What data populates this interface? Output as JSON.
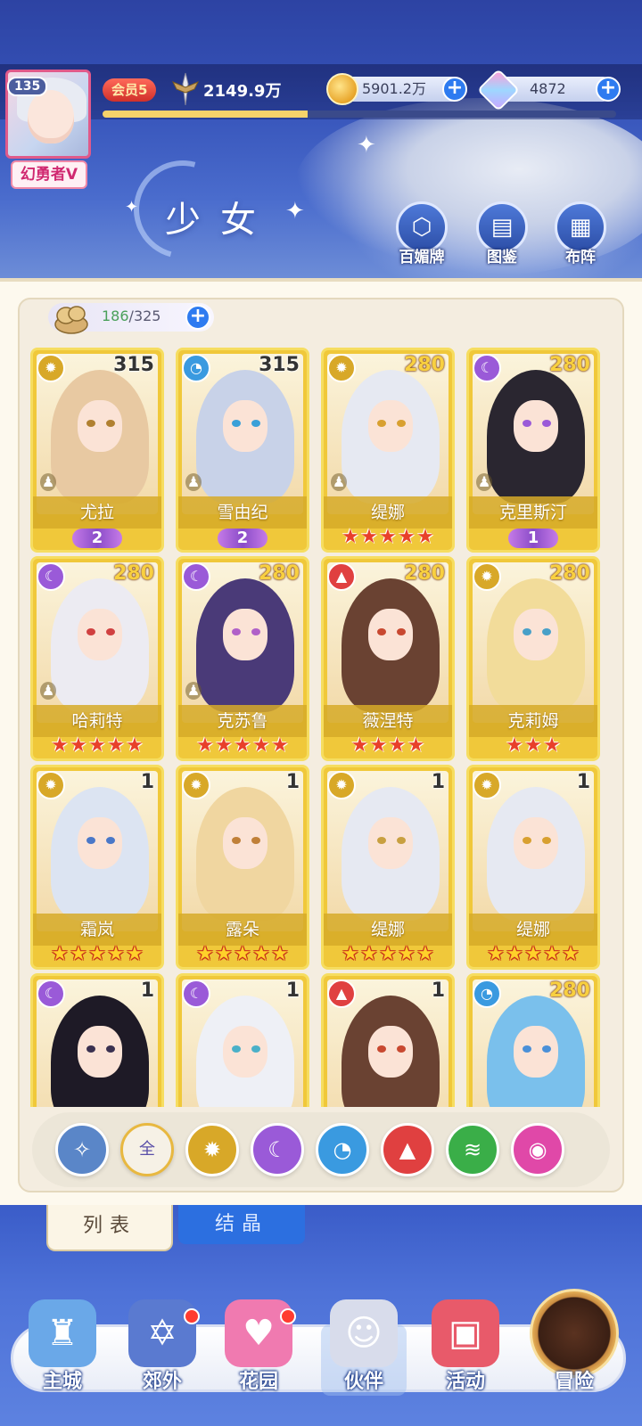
{
  "player": {
    "level": "135",
    "title": "幻勇者V",
    "vip": "会员5",
    "power": "2149.9万",
    "exp_fraction": 0.4
  },
  "currencies": {
    "gold": "5901.2万",
    "diamond": "4872"
  },
  "page": {
    "title": "少女",
    "buttons": [
      {
        "label": "百媚牌",
        "icon": "card-deck-icon"
      },
      {
        "label": "图鉴",
        "icon": "book-icon"
      },
      {
        "label": "布阵",
        "icon": "grid-formation-icon"
      }
    ]
  },
  "inventory": {
    "owned": "186",
    "capacity": "/325"
  },
  "cards": [
    {
      "name": "尤拉",
      "level": "315",
      "element": "light",
      "stars": 0,
      "wing": "2",
      "pawn": true,
      "hair": "#e8c9a2",
      "eye": "#b08030"
    },
    {
      "name": "雪由纪",
      "level": "315",
      "element": "water",
      "stars": 0,
      "wing": "2",
      "pawn": true,
      "hair": "#c8d2e8",
      "eye": "#3aa0d8"
    },
    {
      "name": "缇娜",
      "level": "280",
      "element": "light",
      "stars": 5,
      "star_style": "red",
      "wing": "",
      "pawn": true,
      "hair": "#e6e9f2",
      "eye": "#d8a030"
    },
    {
      "name": "克里斯汀",
      "level": "280",
      "element": "dark",
      "stars": 0,
      "wing": "1",
      "pawn": true,
      "hair": "#2a2630",
      "eye": "#9a5ad8"
    },
    {
      "name": "哈莉特",
      "level": "280",
      "element": "dark",
      "stars": 5,
      "star_style": "red",
      "wing": "",
      "pawn": true,
      "hair": "#ecebf2",
      "eye": "#d04040"
    },
    {
      "name": "克苏鲁",
      "level": "280",
      "element": "dark",
      "stars": 5,
      "star_style": "red",
      "wing": "",
      "pawn": true,
      "hair": "#4a3a78",
      "eye": "#b060c8"
    },
    {
      "name": "薇涅特",
      "level": "280",
      "element": "fire",
      "stars": 4,
      "star_style": "red",
      "wing": "",
      "pawn": false,
      "hair": "#6a4232",
      "eye": "#c84830"
    },
    {
      "name": "克莉姆",
      "level": "280",
      "element": "light",
      "stars": 3,
      "star_style": "red",
      "wing": "",
      "pawn": false,
      "hair": "#f2dc9a",
      "eye": "#48a0c8"
    },
    {
      "name": "霜岚",
      "level": "1",
      "element": "light",
      "stars": 5,
      "star_style": "gold",
      "wing": "",
      "pawn": false,
      "hair": "#dce4f2",
      "eye": "#4a78c8"
    },
    {
      "name": "露朵",
      "level": "1",
      "element": "light",
      "stars": 5,
      "star_style": "gold",
      "wing": "",
      "pawn": false,
      "hair": "#f0d6a0",
      "eye": "#c08038"
    },
    {
      "name": "缇娜",
      "level": "1",
      "element": "light",
      "stars": 5,
      "star_style": "gold",
      "wing": "",
      "pawn": false,
      "hair": "#e6e9f2",
      "eye": "#c8a040"
    },
    {
      "name": "缇娜",
      "level": "1",
      "element": "light",
      "stars": 5,
      "star_style": "gold",
      "wing": "",
      "pawn": false,
      "hair": "#e6e9f2",
      "eye": "#d8a030"
    },
    {
      "name": "",
      "level": "1",
      "element": "dark",
      "stars": 0,
      "wing": "",
      "pawn": false,
      "hair": "#1e1a26",
      "eye": "#3a3050"
    },
    {
      "name": "",
      "level": "1",
      "element": "dark",
      "stars": 0,
      "wing": "",
      "pawn": false,
      "hair": "#eef0f6",
      "eye": "#4ab0c8"
    },
    {
      "name": "",
      "level": "1",
      "element": "fire",
      "stars": 0,
      "wing": "",
      "pawn": false,
      "hair": "#6a4232",
      "eye": "#c84830"
    },
    {
      "name": "",
      "level": "280",
      "element": "water",
      "stars": 0,
      "wing": "",
      "pawn": false,
      "hair": "#7ac0ec",
      "eye": "#4a90d8"
    }
  ],
  "filters": [
    {
      "id": "special",
      "label": "",
      "icon": "star-compass-icon",
      "color": "#5a86c8"
    },
    {
      "id": "all",
      "label": "全",
      "icon": "",
      "color": "#f6f1e6"
    },
    {
      "id": "light",
      "label": "",
      "icon": "sun-icon",
      "color": "#d8a828"
    },
    {
      "id": "dark",
      "label": "",
      "icon": "moon-icon",
      "color": "#9a5ad8"
    },
    {
      "id": "water",
      "label": "",
      "icon": "water-drop-icon",
      "color": "#3a9ae0"
    },
    {
      "id": "fire",
      "label": "",
      "icon": "fire-icon",
      "color": "#e04040"
    },
    {
      "id": "wind",
      "label": "",
      "icon": "whirlwind-icon",
      "color": "#3aae48"
    },
    {
      "id": "spirit",
      "label": "",
      "icon": "orb-icon",
      "color": "#e048a8"
    }
  ],
  "tabs": {
    "list": "列表",
    "crystal": "结晶"
  },
  "nav": [
    {
      "label": "主城",
      "icon": "castle-icon",
      "color": "#6aa8e8",
      "badge": false
    },
    {
      "label": "郊外",
      "icon": "magic-circle-icon",
      "color": "#5a7ad0",
      "badge": true
    },
    {
      "label": "花园",
      "icon": "heart-icon",
      "color": "#f07ab0",
      "badge": true
    },
    {
      "label": "伙伴",
      "icon": "companion-avatar-icon",
      "color": "#d8dceb",
      "badge": false
    },
    {
      "label": "活动",
      "icon": "gift-box-icon",
      "color": "#e85a6a",
      "badge": false
    }
  ],
  "adventure_label": "冒险",
  "colors": {
    "light": "#d8a828",
    "dark": "#9a5ad8",
    "water": "#3a9ae0",
    "fire": "#e04040"
  }
}
